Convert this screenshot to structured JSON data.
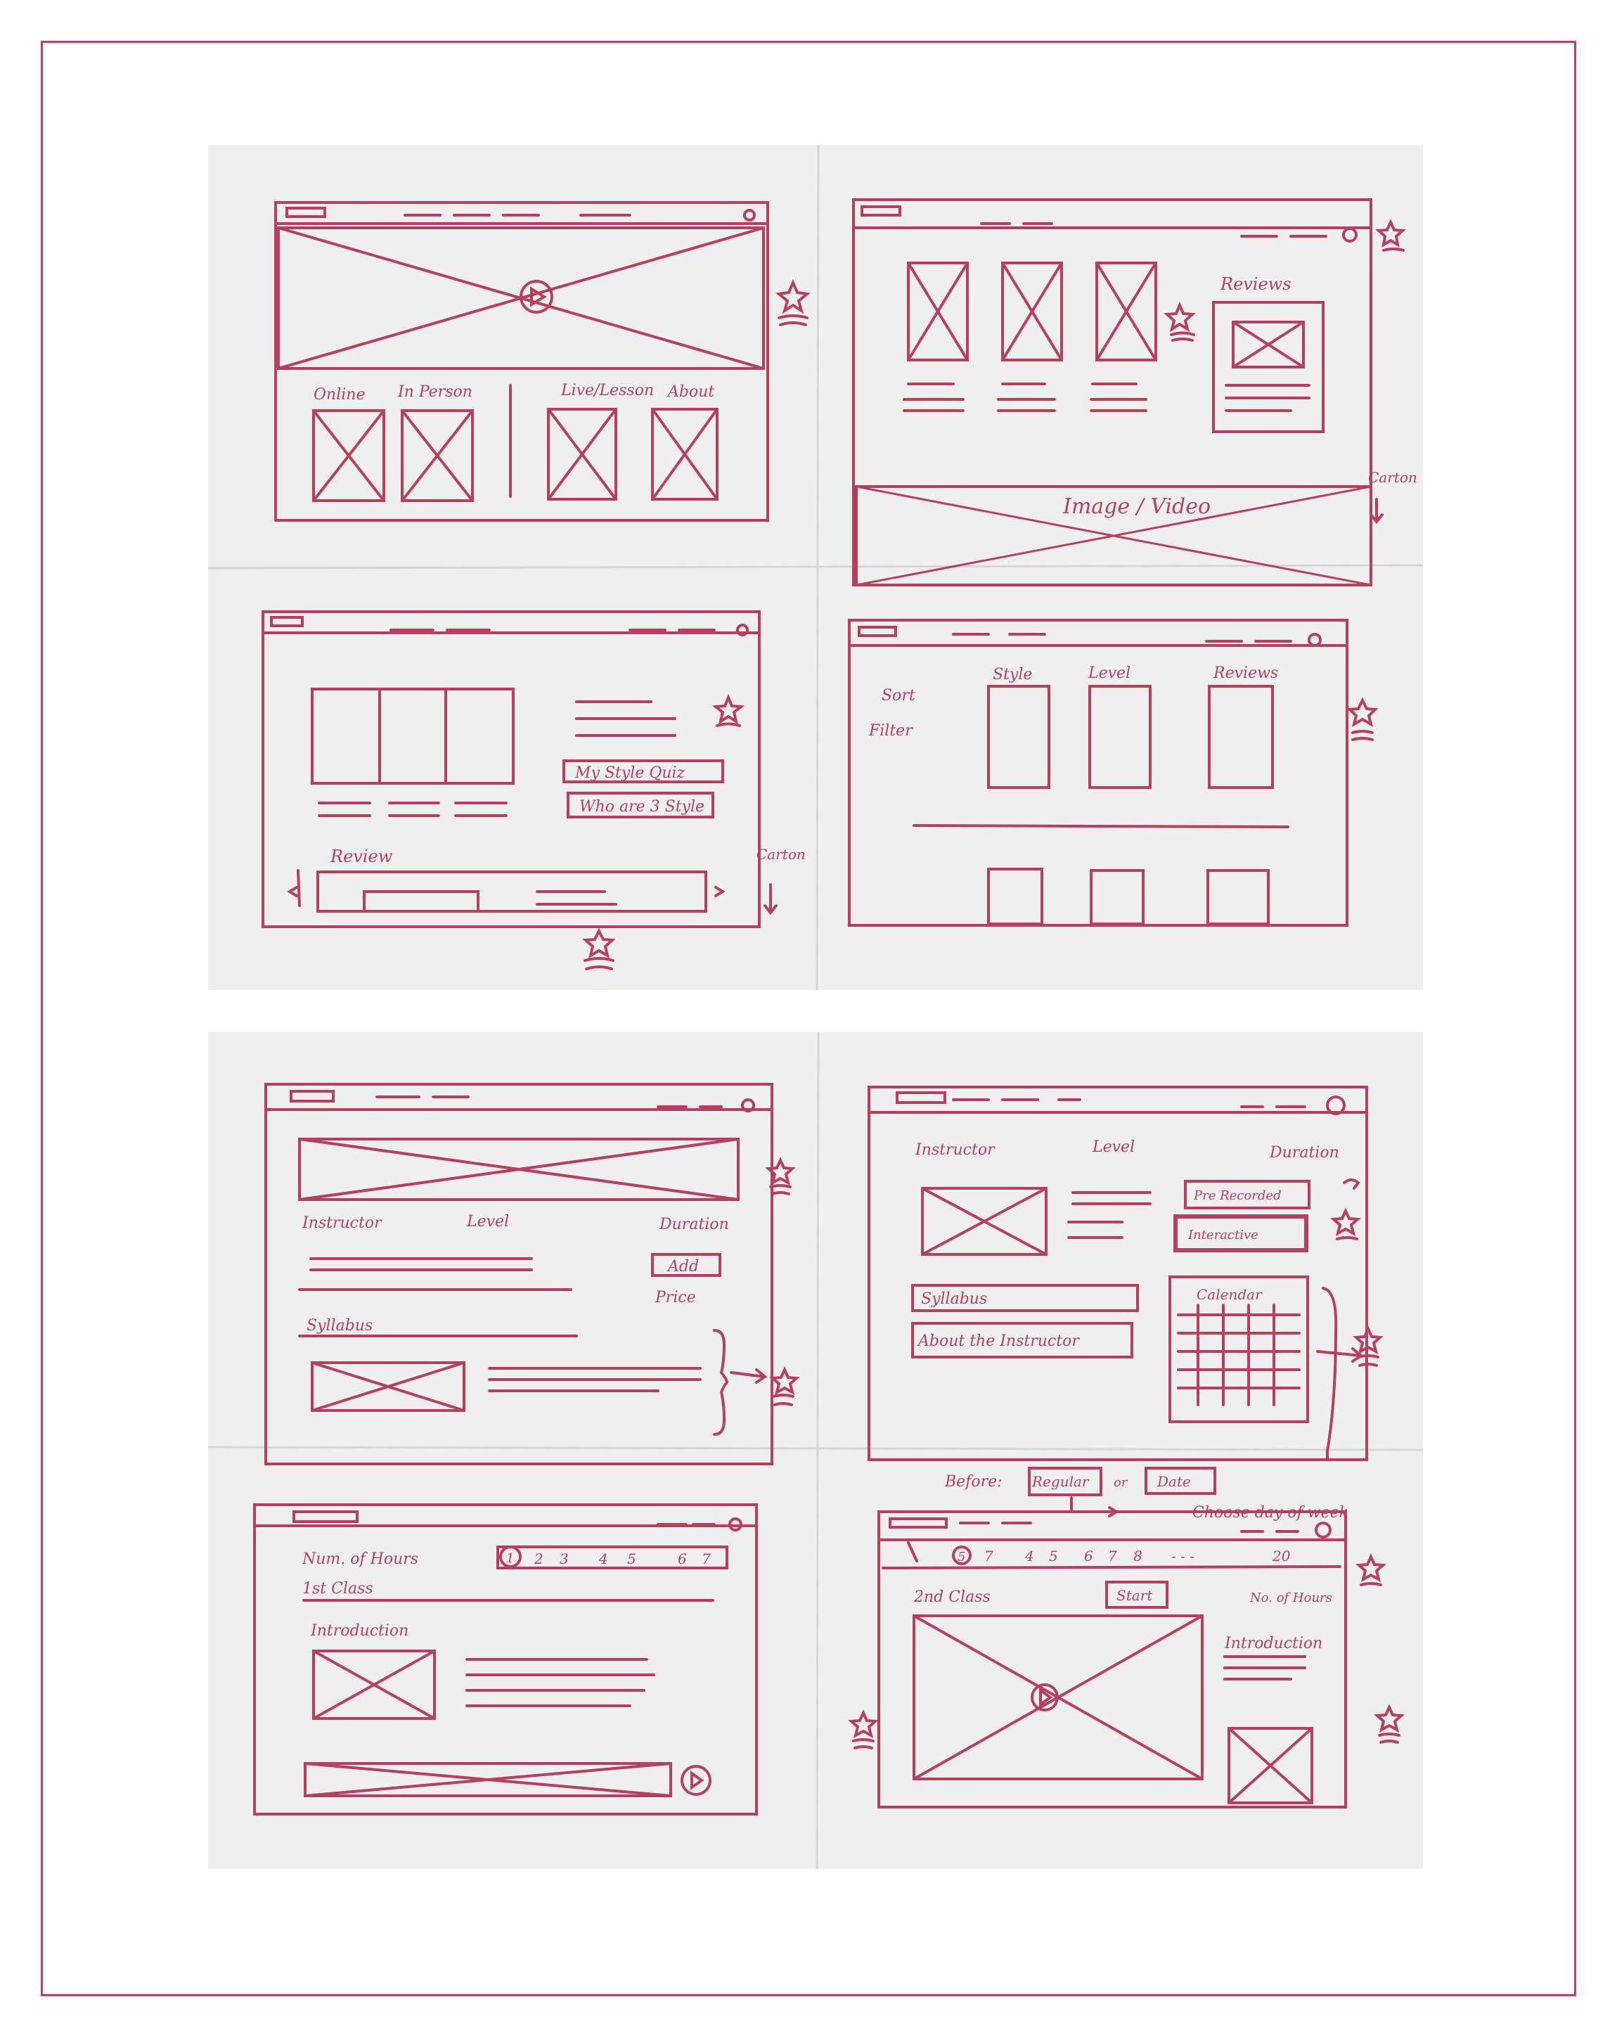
{
  "colors": {
    "ink": "#b8405e",
    "paper": "#efefef",
    "border": "#c0406a"
  },
  "sheet1": {
    "sketch1": {
      "labels": [
        "Online",
        "In Person",
        "Live/Lesson",
        "About"
      ]
    },
    "sketch2": {
      "reviews": "Reviews",
      "footer": "Image / Video",
      "side_note": "Carton"
    },
    "sketch3": {
      "quiz_button": "My Style Quiz",
      "who_button": "Who are 3 Style",
      "review": "Review",
      "side_note": "Carton"
    },
    "sketch4": {
      "sidebar": [
        "Sort",
        "Filter"
      ],
      "columns": [
        "Style",
        "Level",
        "Reviews"
      ]
    }
  },
  "sheet2": {
    "sketch5": {
      "labels": [
        "Instructor",
        "Level",
        "Duration"
      ],
      "add_button": "Add",
      "price": "Price",
      "syllabus": "Syllabus"
    },
    "sketch6": {
      "labels": [
        "Instructor",
        "Level",
        "Duration"
      ],
      "buttons": [
        "Pre Recorded",
        "Interactive"
      ],
      "syllabus": "Syllabus",
      "about": "About the Instructor",
      "calendar": "Calendar",
      "before_label": "Before:",
      "regular": "Regular",
      "or": "or",
      "date": "Date",
      "choose_note": "Choose day of week"
    },
    "sketch7": {
      "hours_label": "Num. of Hours",
      "hours": [
        "1",
        "2",
        "3",
        "4",
        "5",
        "6",
        "7"
      ],
      "class": "1st Class",
      "intro": "Introduction"
    },
    "sketch8": {
      "pager": [
        "5",
        "7",
        "4",
        "5",
        "6",
        "7",
        "8",
        "- - -",
        "20"
      ],
      "hours_note": "No. of Hours",
      "class": "2nd Class",
      "start_button": "Start",
      "intro": "Introduction"
    }
  }
}
